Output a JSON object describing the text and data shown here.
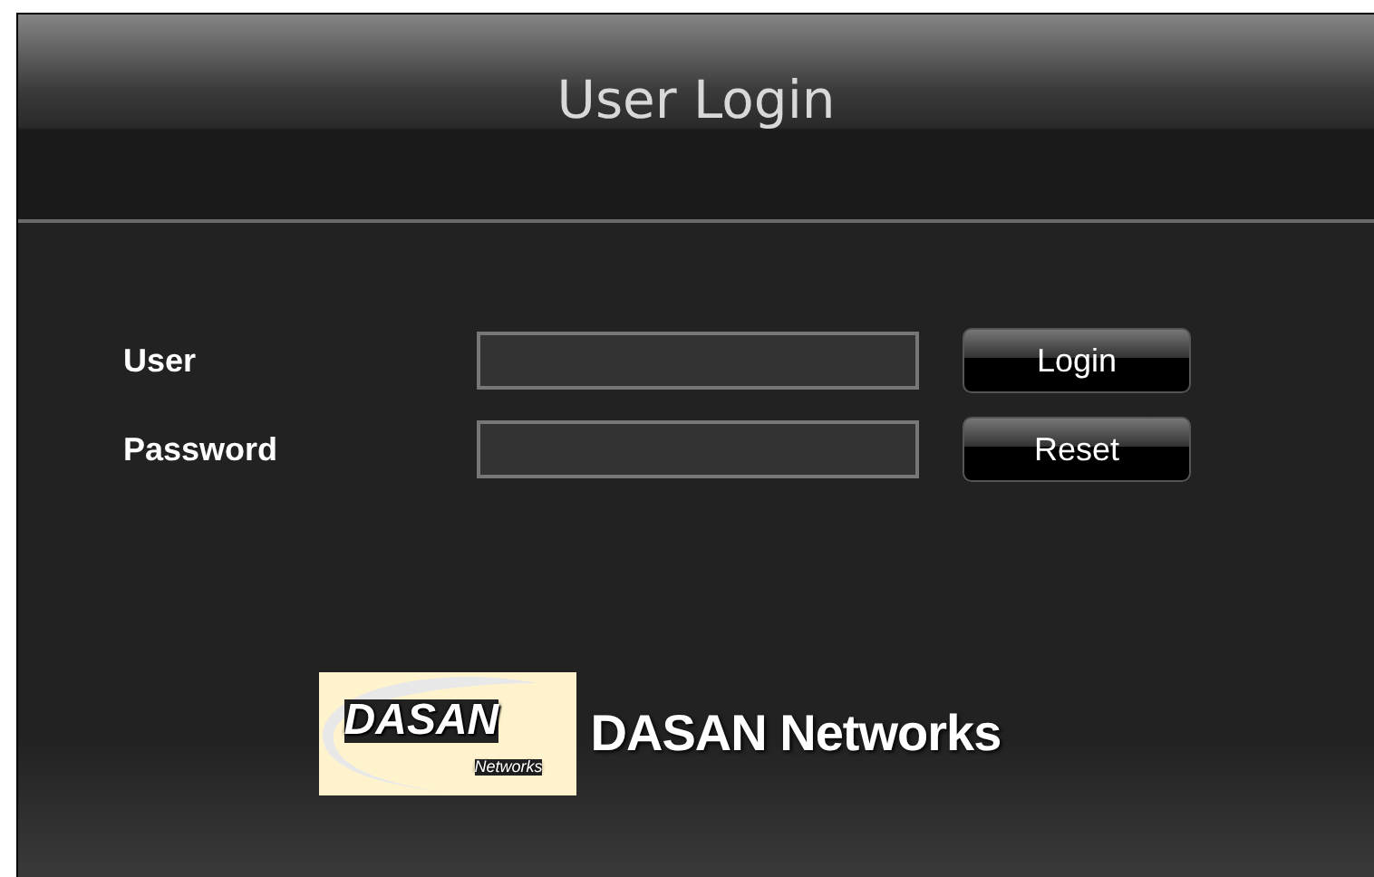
{
  "header": {
    "title": "User Login"
  },
  "fields": [
    {
      "label": "User",
      "button": "Login"
    },
    {
      "label": "Password",
      "button": "Reset"
    }
  ],
  "logo": {
    "mark_text": "DASAN",
    "mark_subtext": "Networks",
    "brand": "DASAN Networks"
  }
}
